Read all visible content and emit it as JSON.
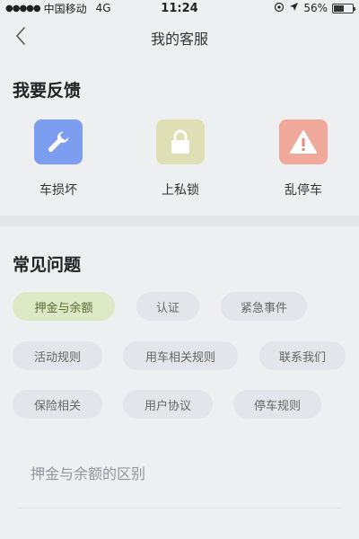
{
  "status_bar": {
    "carrier": "中国移动",
    "network": "4G",
    "time": "11:24",
    "battery": "56%",
    "battery_level": 0.56
  },
  "nav": {
    "title": "我的客服"
  },
  "feedback": {
    "heading": "我要反馈",
    "items": [
      {
        "label": "车损坏",
        "icon": "wrench-icon",
        "color": "#7d9df0"
      },
      {
        "label": "上私锁",
        "icon": "lock-icon",
        "color": "#dedfb5"
      },
      {
        "label": "乱停车",
        "icon": "warning-icon",
        "color": "#f0a89a"
      }
    ]
  },
  "faq": {
    "heading": "常见问题",
    "chips": [
      {
        "label": "押金与余额",
        "active": true
      },
      {
        "label": "认证",
        "active": false
      },
      {
        "label": "紧急事件",
        "active": false
      },
      {
        "label": "活动规则",
        "active": false
      },
      {
        "label": "用车相关规则",
        "active": false
      },
      {
        "label": "联系我们",
        "active": false
      },
      {
        "label": "保险相关",
        "active": false
      },
      {
        "label": "用户协议",
        "active": false
      },
      {
        "label": "停车规则",
        "active": false
      }
    ],
    "answer_title": "押金与余额的区别"
  },
  "colors": {
    "active_chip": "#dde8c4",
    "chip": "#e2e5ea",
    "background": "#eeeff1"
  }
}
